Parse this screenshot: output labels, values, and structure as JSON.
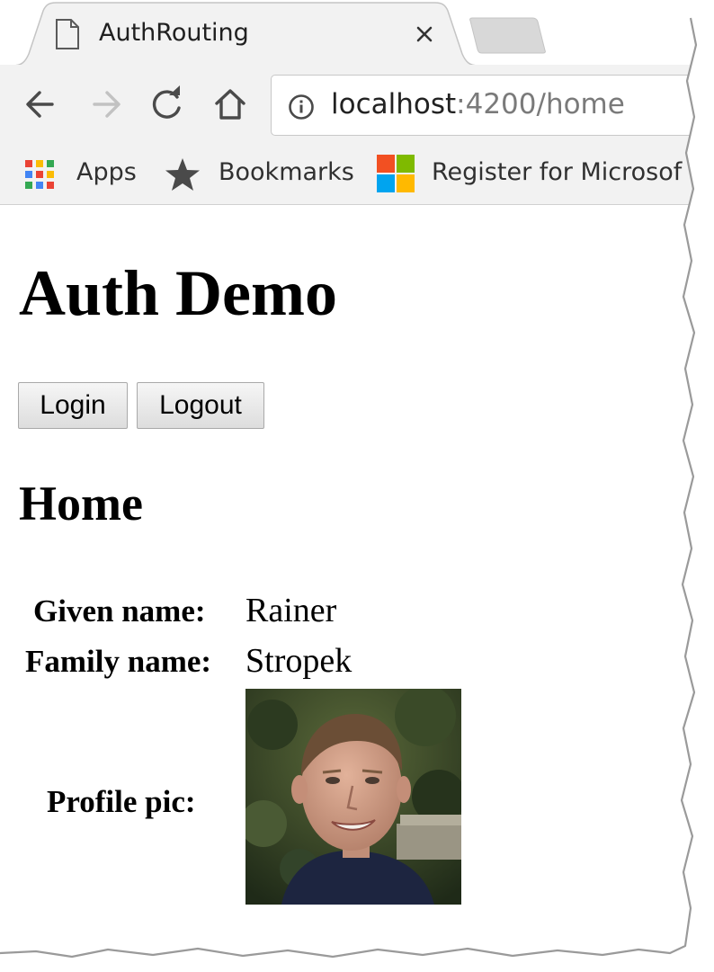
{
  "browser": {
    "tab": {
      "title": "AuthRouting"
    },
    "address": {
      "host": "localhost",
      "rest": ":4200/home"
    },
    "bookmarks": [
      {
        "label": "Apps",
        "icon": "apps-grid-icon"
      },
      {
        "label": "Bookmarks",
        "icon": "star-icon"
      },
      {
        "label": "Register for Microsof",
        "icon": "microsoft-logo-icon"
      }
    ]
  },
  "page": {
    "title": "Auth Demo",
    "buttons": {
      "login": "Login",
      "logout": "Logout"
    },
    "section_title": "Home",
    "profile": {
      "given_name_label": "Given name:",
      "given_name": "Rainer",
      "family_name_label": "Family name:",
      "family_name": "Stropek",
      "pic_label": "Profile pic:"
    }
  },
  "colors": {
    "chrome_bg": "#f2f2f2",
    "ms_red": "#f25022",
    "ms_green": "#7fba00",
    "ms_blue": "#00a4ef",
    "ms_yellow": "#ffb900"
  }
}
